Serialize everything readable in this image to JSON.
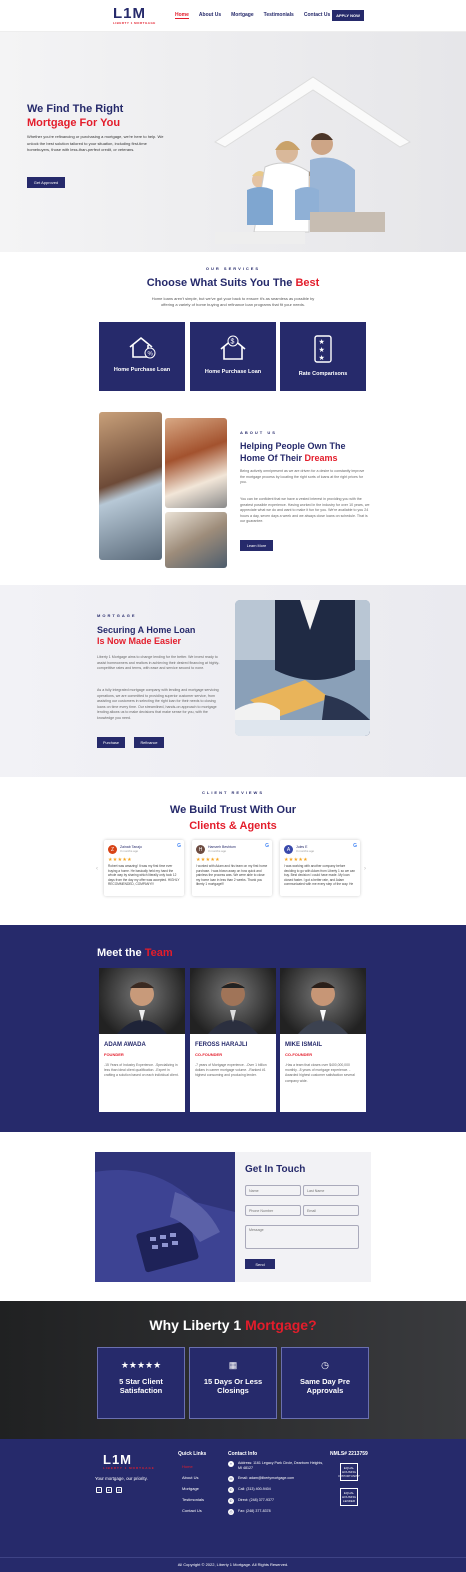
{
  "header": {
    "logo": "L1M",
    "logo_sub": "LIBERTY 1 MORTGAGE",
    "nav": [
      "Home",
      "About Us",
      "Mortgage",
      "Testimonials",
      "Contact Us"
    ],
    "apply": "APPLY NOW"
  },
  "hero": {
    "title1": "We Find The Right",
    "title2": "Mortgage For You",
    "text": "Whether you're refinancing or purchasing a mortgage, we're here to help. We unlock the best solution tailored to your situation, including first-time homebuyers, those with less-than-perfect credit, or veterans.",
    "cta": "Get Approved"
  },
  "services": {
    "kicker": "OUR SERVICES",
    "title1": "Choose What Suits You The",
    "title2": "Best",
    "text": "Home loans aren't simple, but we've got your back to ensure it's as seamless as possible by offering a variety of home buying and refinance loan programs that fit your needs.",
    "cards": [
      "Home Purchase Loan",
      "Home Purchase Loan",
      "Rate Comparisons"
    ]
  },
  "about": {
    "kicker": "ABOUT US",
    "title1": "Helping People Own The",
    "title2": "Home Of Their",
    "title3": "Dreams",
    "p1": "Being actively omnipresent as we are driven for a desire to constantly improve the mortgage process by locating the right sorts of loans at the right prices for you.",
    "p2": "You can be confident that we have a vested interest in providing you with the greatest possible experience. Having worked in the industry for over 10 years, we appreciate what we do and want to make it fun for you. We're available to you 24 hours a day, seven days a week and we always close loans on schedule. That is our guarantee.",
    "cta": "Learn More"
  },
  "mortgage": {
    "kicker": "MORTGAGE",
    "title1": "Securing A Home Loan",
    "title2": "Is Now Made Easier",
    "p1": "Liberty 1 Mortgage aims to change lending for the better. We invest ready to assist homeowners and realtors in achieving their desired financing at highly-competitive rates and terms, with ease and service second to none.",
    "p2": "As a fully integrated mortgage company with lending and mortgage servicing operations, we are committed to providing superior customer service, from assisting our customers in selecting the right loan for their needs to closing loans on time every time. Our streamlined, hands-on approach to mortgage lending allows us to make decisions that make sense for you, with the knowledge you need.",
    "b1": "Purchase",
    "b2": "Refinance"
  },
  "reviews": {
    "kicker": "CLIENT REVIEWS",
    "title1": "We Build Trust With Our",
    "title2": "Clients & Agents",
    "items": [
      {
        "initial": "Z",
        "name": "Zainab Tanajo",
        "date": "3 months ago",
        "stars": "★★★★★",
        "text": "Robert was amazing! It was my first time ever buying a home. He basically held my hand the whole way by sharing which literally only took 12 days from the day my offer was accepted. HIGHLY RECOMMENDED, COMPANY!!!",
        "color": "#d84315"
      },
      {
        "initial": "H",
        "name": "Hamzeh Beshtum",
        "date": "3 months ago",
        "stars": "★★★★★",
        "text": "I worked with Adam and his team on my first home purchase. I was blown away on how quick and painless the process was. We were able to close my home loan in less than 2 weeks. Thank you liberty 1 mortgage!!!",
        "color": "#6d4c41"
      },
      {
        "initial": "A",
        "name": "Jules E",
        "date": "3 months ago",
        "stars": "★★★★★",
        "text": "I was working with another company before deciding to go with Adam from Liberty 1 so we can buy. Best decision I could have made. My loan closed faster. I got a better rate, and Adam communicated with me every step of the way. He",
        "color": "#3949ab"
      }
    ]
  },
  "team": {
    "title1": "Meet the",
    "title2": "Team",
    "members": [
      {
        "name": "ADAM AWADA",
        "role": "FOUNDER",
        "bio": "-15 Years of Industry Experience. -Specializing in less than ideal client qualification. -Expert in crafting a solution based on each individual client."
      },
      {
        "name": "FEROSS HARAJLI",
        "role": "CO-FOUNDER",
        "bio": "-7 years of Mortgage experience. -Over 1 billion dollars in career mortgage volume. -Ranked #1 highest consuming and producing lender."
      },
      {
        "name": "MIKE ISMAIL",
        "role": "CO-FOUNDER",
        "bio": "-Has a team that closes over $400,000,000 monthly. -8 years of mortgage experience. -Awarded highest customer satisfaction several company wide."
      }
    ]
  },
  "contact": {
    "title": "Get In Touch",
    "name_ph": "Name",
    "last_ph": "Last Name",
    "phone_ph": "Phone Number",
    "email_ph": "Email",
    "msg_ph": "Message",
    "send": "Send"
  },
  "why": {
    "title1": "Why Liberty 1",
    "title2": "Mortgage?",
    "cards": [
      {
        "icon": "★★★★★",
        "l1": "5 Star Client",
        "l2": "Satisfaction"
      },
      {
        "icon": "▦",
        "l1": "15 Days Or Less",
        "l2": "Closings"
      },
      {
        "icon": "◷",
        "l1": "Same Day Pre",
        "l2": "Approvals"
      }
    ]
  },
  "footer": {
    "logo": "L1M",
    "logo_sub": "LIBERTY 1 MORTGAGE",
    "tagline": "Your mortgage, our priority.",
    "ql": "Quick Links",
    "links": [
      "Home",
      "About Us",
      "Mortgage",
      "Testimonials",
      "Contact Us"
    ],
    "ci": "Contact Info",
    "address": "Address: 1161 Legacy Park Circle, Dearborn Heights, MI 48127",
    "email": "Email: adam@libertymortgage.com",
    "call": "Call: (313) 400-9404",
    "direct": "Direct: (248) 377-9377",
    "fax": "Fax: (248) 377-8378",
    "nmls": "NMLS# 2213759",
    "eho1": "EQUAL HOUSING OPPORTUNITY",
    "eho2": "EQUAL HOUSING LENDER",
    "copy": "All Copyright © 2022, Liberty 1 Mortgage. All Rights Reserved."
  }
}
